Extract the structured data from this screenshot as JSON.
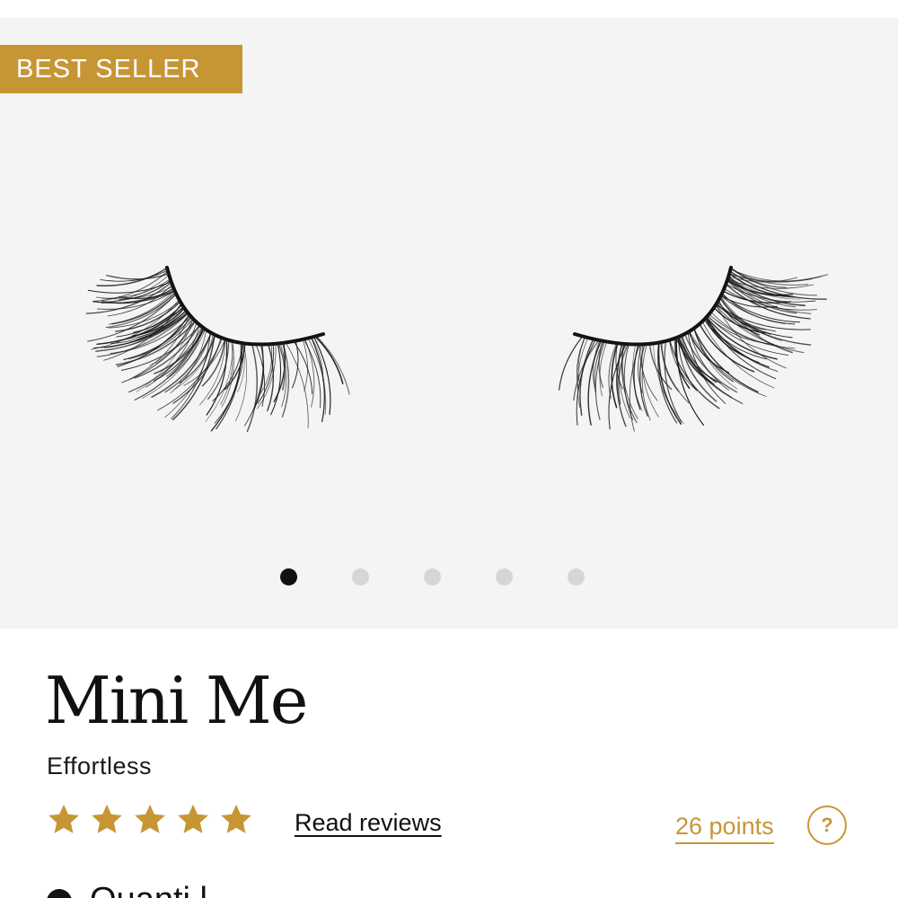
{
  "badge": {
    "label": "BEST SELLER",
    "color": "#c79634"
  },
  "gallery": {
    "image": "false-eyelashes-pair",
    "slide_count": 5,
    "active_slide": 1
  },
  "product": {
    "name": "Mini Me",
    "style": "Effortless",
    "rating": {
      "stars": 5,
      "max": 5,
      "star_color": "#c79634",
      "reviews_link": "Read reviews"
    },
    "points": {
      "label": "26 points",
      "help_icon": "question-circle-icon",
      "help_glyph": "?"
    }
  },
  "next_section": {
    "partial_text": "Quanti   l"
  },
  "colors": {
    "accent": "#c79634",
    "gallery_bg": "#f4f4f4",
    "text": "#111111"
  }
}
